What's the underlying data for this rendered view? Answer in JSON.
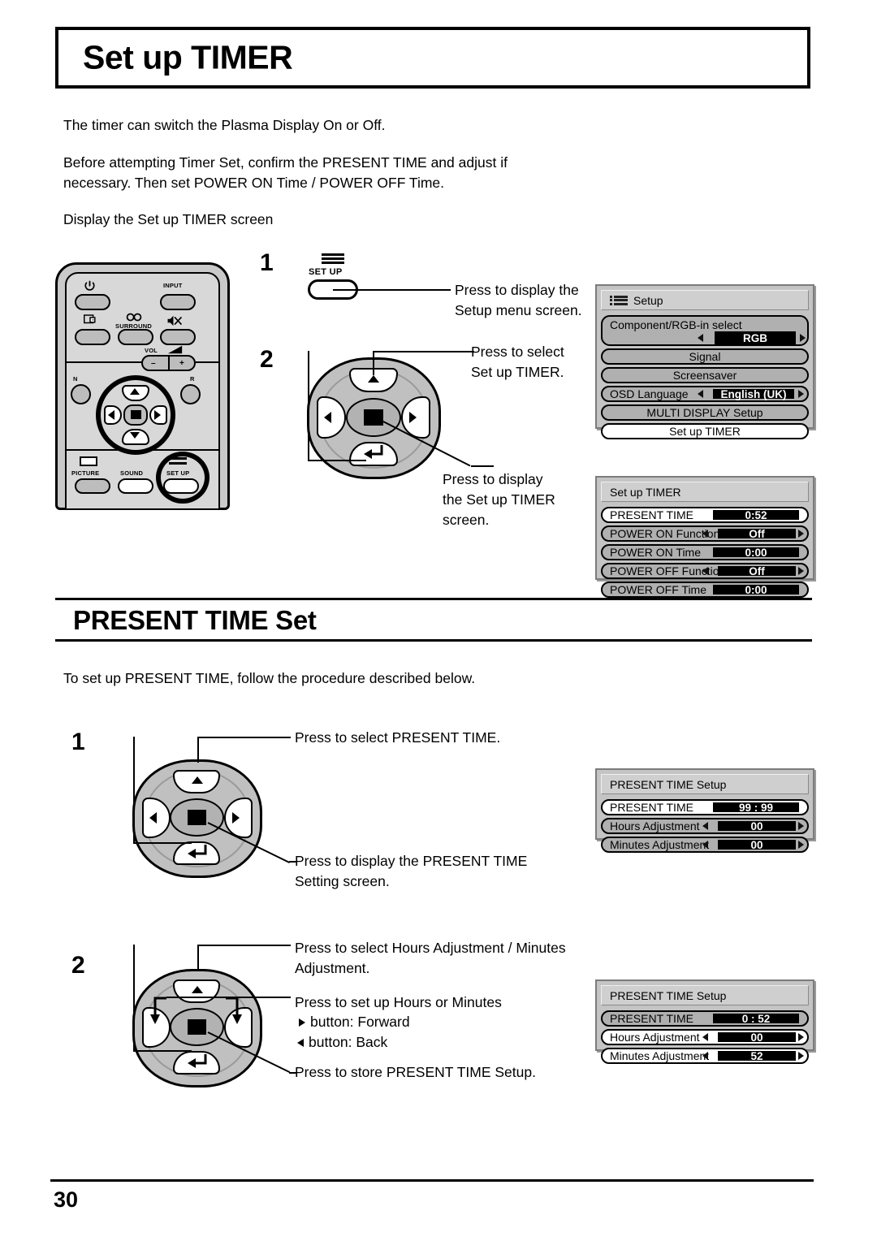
{
  "header": {
    "title": "Set up TIMER"
  },
  "intro": {
    "line1": "The timer can switch the Plasma Display On or Off.",
    "line2": "Before attempting Timer Set, confirm the PRESENT TIME and adjust if\nnecessary. Then set POWER ON Time / POWER OFF Time.",
    "line3": "Display the Set up TIMER screen"
  },
  "section2": {
    "heading": "PRESENT TIME Set",
    "intro": "To set up PRESENT TIME, follow the procedure described below."
  },
  "footer": {
    "page_number": "30"
  },
  "remote": {
    "labels": {
      "input": "INPUT",
      "surround": "SURROUND",
      "vol": "VOL",
      "n": "N",
      "r": "R",
      "picture": "PICTURE",
      "sound": "SOUND",
      "setup": "SET UP",
      "vol_minus": "–",
      "vol_plus": "+"
    }
  },
  "steps_timer": [
    {
      "number": "1",
      "button_label": "SET UP",
      "callout": "Press to display the\nSetup menu screen."
    },
    {
      "number": "2",
      "callout_up": "Press to select\nSet up TIMER.",
      "callout_enter": "Press to display\nthe Set up TIMER\nscreen."
    }
  ],
  "steps_present_time": [
    {
      "number": "1",
      "callout_up": "Press to select PRESENT TIME.",
      "callout_enter": "Press to display the PRESENT TIME\nSetting screen."
    },
    {
      "number": "2",
      "callout_up": "Press to select Hours Adjustment /  Minutes\nAdjustment.",
      "callout_lr_title": "Press to set up Hours or Minutes",
      "callout_lr_forward": "button: Forward",
      "callout_lr_back": "button: Back",
      "callout_enter": "Press to store PRESENT TIME Setup."
    }
  ],
  "osd_setup": {
    "title": "Setup",
    "icon": "setup-list-icon",
    "rows": [
      {
        "label": "Component/RGB-in  select",
        "value": "RGB",
        "type": "two-line-adjust",
        "selected": false
      },
      {
        "label": "Signal",
        "value": "",
        "type": "center",
        "selected": false
      },
      {
        "label": "Screensaver",
        "value": "",
        "type": "center",
        "selected": false
      },
      {
        "label": "OSD  Language",
        "value": "English (UK)",
        "type": "adjust",
        "selected": false
      },
      {
        "label": "MULTI DISPLAY Setup",
        "value": "",
        "type": "center",
        "selected": false
      },
      {
        "label": "Set up TIMER",
        "value": "",
        "type": "center",
        "selected": true
      }
    ]
  },
  "osd_timer": {
    "title": "Set up TIMER",
    "rows": [
      {
        "label": "PRESENT TIME",
        "value": "0:52",
        "type": "value",
        "selected": true
      },
      {
        "label": "POWER ON Function",
        "value": "Off",
        "type": "adjust",
        "selected": false
      },
      {
        "label": "POWER ON Time",
        "value": "0:00",
        "type": "value",
        "selected": false
      },
      {
        "label": "POWER OFF Function",
        "value": "Off",
        "type": "adjust",
        "selected": false
      },
      {
        "label": "POWER OFF Time",
        "value": "0:00",
        "type": "value",
        "selected": false
      }
    ]
  },
  "osd_present_time_1": {
    "title": "PRESENT TIME Setup",
    "rows": [
      {
        "label": "PRESENT TIME",
        "value": "99 : 99",
        "type": "value",
        "selected": true
      },
      {
        "label": "Hours Adjustment",
        "value": "00",
        "type": "adjust",
        "selected": false
      },
      {
        "label": "Minutes Adjustment",
        "value": "00",
        "type": "adjust",
        "selected": false
      }
    ]
  },
  "osd_present_time_2": {
    "title": "PRESENT TIME Setup",
    "rows": [
      {
        "label": "PRESENT TIME",
        "value": "0 : 52",
        "type": "value",
        "selected": false
      },
      {
        "label": "Hours Adjustment",
        "value": "00",
        "type": "adjust",
        "selected": false
      },
      {
        "label": "Minutes Adjustment",
        "value": "52",
        "type": "adjust",
        "selected": false
      }
    ]
  }
}
